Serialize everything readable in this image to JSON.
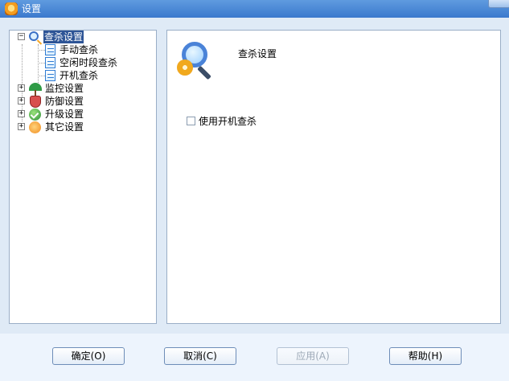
{
  "window": {
    "title": "设置"
  },
  "tree": {
    "items": [
      {
        "label": "查杀设置",
        "expander": "−",
        "icon": "search-settings-icon",
        "selected": true
      },
      {
        "label": "手动查杀",
        "icon": "document-icon"
      },
      {
        "label": "空闲时段查杀",
        "icon": "document-icon"
      },
      {
        "label": "开机查杀",
        "icon": "document-icon"
      },
      {
        "label": "监控设置",
        "expander": "+",
        "icon": "umbrella-icon"
      },
      {
        "label": "防御设置",
        "expander": "+",
        "icon": "shield-icon"
      },
      {
        "label": "升级设置",
        "expander": "+",
        "icon": "upgrade-icon"
      },
      {
        "label": "其它设置",
        "expander": "+",
        "icon": "other-settings-icon"
      }
    ]
  },
  "main": {
    "title": "查杀设置",
    "icon": "scan-settings-icon",
    "startup_scan_label": "使用开机查杀",
    "startup_scan_checked": false
  },
  "buttons": {
    "ok": "确定(O)",
    "cancel": "取消(C)",
    "apply": "应用(A)",
    "help": "帮助(H)"
  },
  "colors": {
    "titlebar": "#3b79cd",
    "selected_tree_item": "#2d5496",
    "panel_border": "#9aaec7",
    "disabled_text": "#9da9b7"
  }
}
